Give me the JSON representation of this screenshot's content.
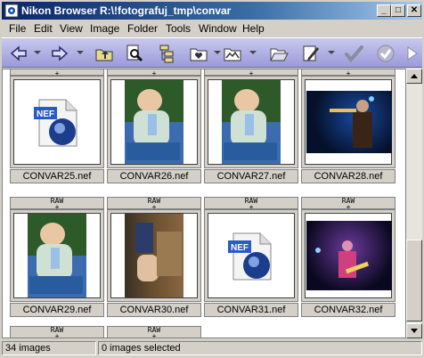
{
  "window": {
    "title": "Nikon Browser R:\\!fotografuj_tmp\\convar"
  },
  "title_buttons": {
    "minimize": "_",
    "maximize": "□",
    "close": "✕"
  },
  "menu": [
    "File",
    "Edit",
    "View",
    "Image",
    "Folder",
    "Tools",
    "Window",
    "Help"
  ],
  "toolbar": {
    "icons": [
      "back-icon",
      "forward-icon",
      "up-folder-icon",
      "search-icon",
      "tree-view-icon",
      "favorites-folder-icon",
      "slideshow-icon",
      "open-folder-icon",
      "edit-icon",
      "check-icon",
      "check-circle-icon",
      "next-icon"
    ]
  },
  "grid": {
    "raw_label": "RAW",
    "plus": "+",
    "cells": [
      {
        "name": "CONVAR25.nef",
        "type": "nef-icon"
      },
      {
        "name": "CONVAR26.nef",
        "type": "baby-photo"
      },
      {
        "name": "CONVAR27.nef",
        "type": "baby-photo"
      },
      {
        "name": "CONVAR28.nef",
        "type": "concert-trumpet"
      },
      {
        "name": "CONVAR29.nef",
        "type": "baby-photo"
      },
      {
        "name": "CONVAR30.nef",
        "type": "room-photo"
      },
      {
        "name": "CONVAR31.nef",
        "type": "nef-icon"
      },
      {
        "name": "CONVAR32.nef",
        "type": "concert-guitar"
      }
    ],
    "nef_text": "NEF"
  },
  "status": {
    "count": "34 images",
    "selected": "0 images selected"
  },
  "colors": {
    "toolbar": "#9b9bd9",
    "titlebar": "#0a246a"
  }
}
